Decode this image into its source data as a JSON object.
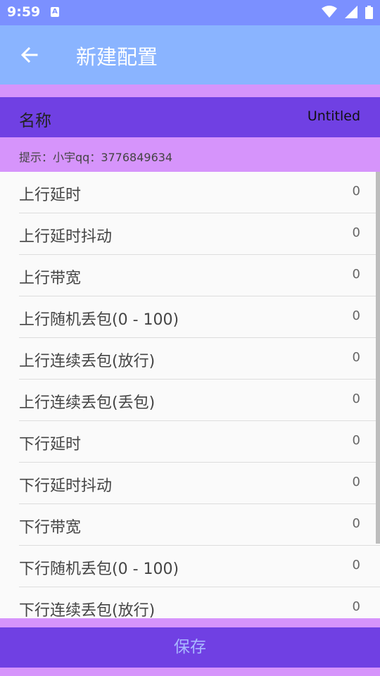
{
  "status_bar": {
    "time": "9:59",
    "notification_letter": "A"
  },
  "app_bar": {
    "title": "新建配置",
    "back_icon": "arrow-left-icon"
  },
  "name": {
    "label": "名称",
    "value": "Untitled"
  },
  "hint": "提示：小宇qq：3776849634",
  "items": [
    {
      "label": "上行延时",
      "value": "0"
    },
    {
      "label": "上行延时抖动",
      "value": "0"
    },
    {
      "label": "上行带宽",
      "value": "0"
    },
    {
      "label": "上行随机丢包(0 - 100)",
      "value": "0"
    },
    {
      "label": "上行连续丢包(放行)",
      "value": "0"
    },
    {
      "label": "上行连续丢包(丢包)",
      "value": "0"
    },
    {
      "label": "下行延时",
      "value": "0"
    },
    {
      "label": "下行延时抖动",
      "value": "0"
    },
    {
      "label": "下行带宽",
      "value": "0"
    },
    {
      "label": "下行随机丢包(0 - 100)",
      "value": "0"
    },
    {
      "label": "下行连续丢包(放行)",
      "value": "0"
    }
  ],
  "save_button": "保存",
  "colors": {
    "status_bar": "#7b90ff",
    "app_bar": "#8ab4ff",
    "accent_purple": "#7040e3",
    "light_purple": "#d694fb"
  }
}
